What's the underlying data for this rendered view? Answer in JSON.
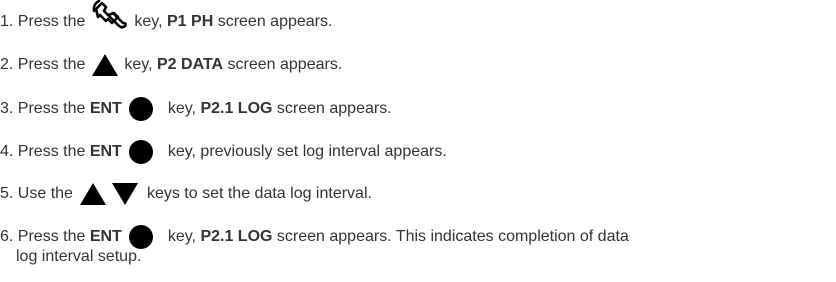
{
  "steps": [
    {
      "num": "1. ",
      "pre": "Press the",
      "key_icon": "wrench-icon",
      "post1": "key, ",
      "bold1": "P1 PH",
      "post2": " screen appears."
    },
    {
      "num": "2. ",
      "pre": "Press the",
      "key_icon": "triangle-up-icon",
      "post1": "key, ",
      "bold1": "P2 DATA",
      "post2": " screen appears."
    },
    {
      "num": "3. ",
      "pre": "Press the ",
      "key_label": "ENT",
      "key_icon": "filled-circle-icon",
      "post1": "key, ",
      "bold1": "P2.1 LOG",
      "post2": " screen appears."
    },
    {
      "num": "4. ",
      "pre": "Press the ",
      "key_label": "ENT",
      "key_icon": "filled-circle-icon",
      "post1": "key, previously set log interval appears."
    },
    {
      "num": "5. ",
      "pre": "Use the",
      "key_icons": [
        "triangle-up-icon",
        "triangle-down-icon"
      ],
      "post1": "keys to set the data log interval."
    },
    {
      "num": "6. ",
      "pre": "Press the ",
      "key_label": "ENT",
      "key_icon": "filled-circle-icon",
      "post1": "key, ",
      "bold1": "P2.1 LOG",
      "post2": " screen appears. This indicates completion of data",
      "cont": "log interval setup."
    }
  ],
  "colors": {
    "text": "#333333",
    "icon": "#000000"
  }
}
